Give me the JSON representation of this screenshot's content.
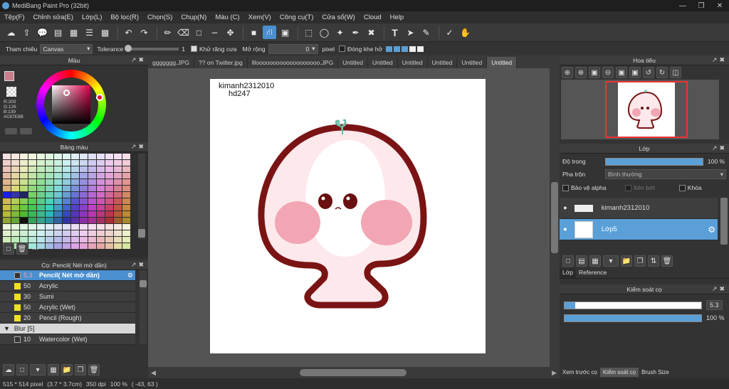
{
  "window": {
    "title": "MediBang Paint Pro (32bit)"
  },
  "menu": [
    "Tệp(F)",
    "Chỉnh sửa(E)",
    "Lớp(L)",
    "Bộ lọc(R)",
    "Chọn(S)",
    "Chụp(N)",
    "Màu (C)",
    "Xem(V)",
    "Công cụ(T)",
    "Cửa sổ(W)",
    "Cloud",
    "Help"
  ],
  "options": {
    "ref_label": "Tham chiếu",
    "ref_value": "Canvas",
    "tolerance_label": "Tolerance",
    "tolerance_value": "1",
    "antialias_label": "Khử răng cưa",
    "expand_label": "Mở rộng",
    "expand_value": "0",
    "expand_unit": "pixel",
    "gap_label": "Đóng khe hở"
  },
  "color_panel": {
    "title": "Màu",
    "r": "R:200",
    "g": "G:126",
    "b": "B:139",
    "hex": "#C87E8B"
  },
  "palette_panel": {
    "title": "Bảng màu",
    "footer": "---"
  },
  "brush_panel": {
    "title": "Cọ: Pencil( Nét mờ dần)",
    "items": [
      {
        "size": "5.3",
        "name": "Pencil( Nét mờ dần)"
      },
      {
        "size": "50",
        "name": "Acrylic"
      },
      {
        "size": "30",
        "name": "Sumi"
      },
      {
        "size": "50",
        "name": "Acrylic (Wet)"
      },
      {
        "size": "20",
        "name": "Pencil (Rough)"
      }
    ],
    "group": "Blur [5]",
    "group_item": {
      "size": "10",
      "name": "Watercolor (Wet)"
    }
  },
  "tabs": [
    "ggggggg.JPG",
    "?? on Twitter.jpg",
    "lllooooooooooooooooooo.JPG",
    "Untitled",
    "Untitled",
    "Untitled",
    "Untitled",
    "Untitled",
    "Untitled"
  ],
  "canvas": {
    "text1": "kimanh2312010",
    "text2": "hd247"
  },
  "status": {
    "size": "515 * 514 pixel",
    "cm": "(3.7 * 3.7cm)",
    "dpi": "350 dpi",
    "zoom": "100 %",
    "coords": "( -43, 63 )"
  },
  "navigator": {
    "title": "Hoa tiêu"
  },
  "layer_panel": {
    "title": "Lớp",
    "opacity_label": "Độ trong",
    "opacity_value": "100 %",
    "blend_label": "Pha trộn",
    "blend_value": "Bình thường",
    "protect_alpha": "Bảo vệ alpha",
    "clip": "Xén bớt",
    "lock": "Khóa",
    "layers": [
      {
        "name": "kimanh2312010"
      },
      {
        "name": "Lớp5"
      }
    ],
    "tab_layer": "Lớp",
    "tab_ref": "Reference"
  },
  "brush_control": {
    "title": "Kiểm soát cọ",
    "size_value": "5.3",
    "opacity_value": "100 %",
    "size_fraction": 0.08,
    "opacity_fraction": 1.0,
    "tabs": [
      "Xem trước cọ",
      "Kiểm soát cọ",
      "Brush Size"
    ]
  },
  "colors": {
    "accent": "#4a8fd0",
    "current_color": "#C87E8B",
    "mushroom_outline": "#7a1414",
    "blush": "#f2a6b4"
  }
}
